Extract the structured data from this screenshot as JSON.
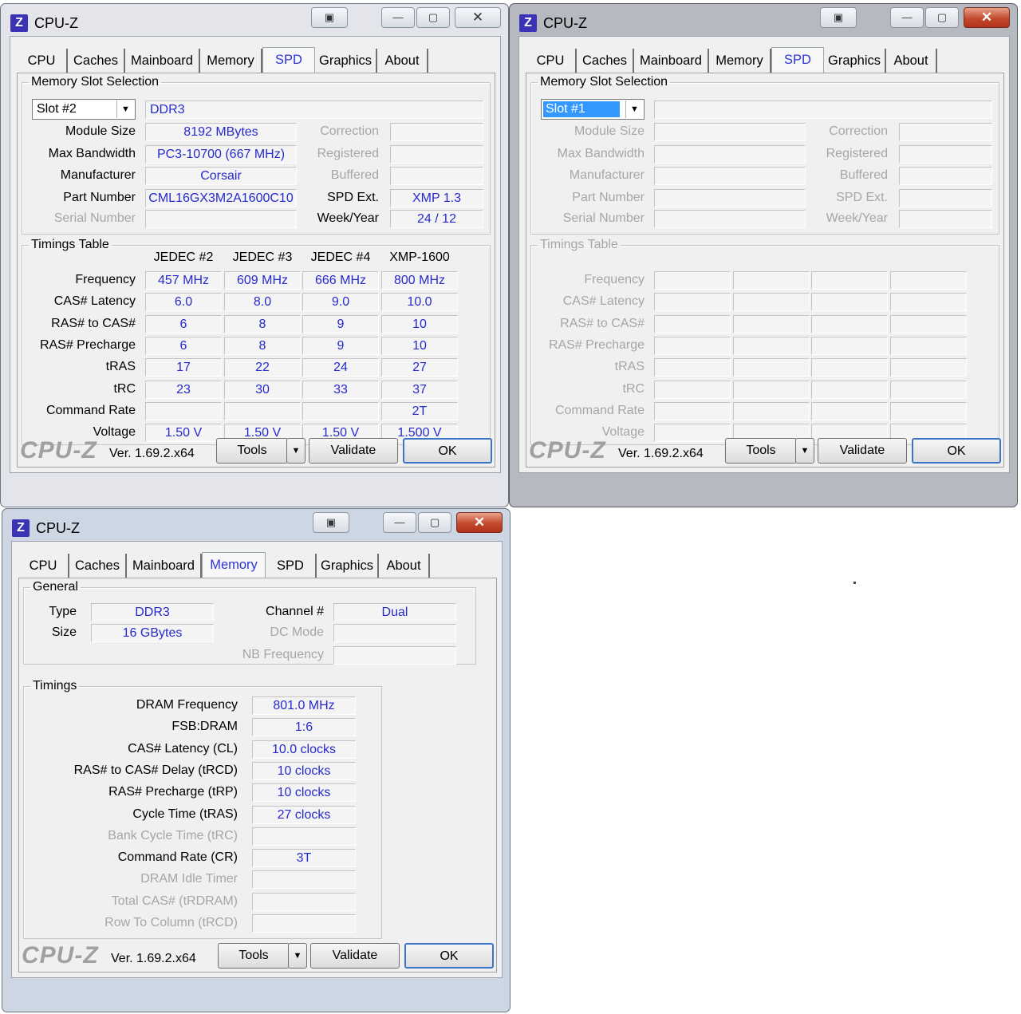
{
  "app_title": "CPU-Z",
  "app_icon_letter": "Z",
  "logo": "CPU-Z",
  "version": "Ver. 1.69.2.x64",
  "buttons": {
    "tools": "Tools",
    "validate": "Validate",
    "ok": "OK",
    "dropdown_glyph": "▼",
    "minimize": "—",
    "maximize": "▢",
    "close": "✕"
  },
  "tabs": [
    "CPU",
    "Caches",
    "Mainboard",
    "Memory",
    "SPD",
    "Graphics",
    "About"
  ],
  "spd_labels": {
    "group_slot": "Memory Slot Selection",
    "module_size": "Module Size",
    "max_bandwidth": "Max Bandwidth",
    "manufacturer": "Manufacturer",
    "part_number": "Part Number",
    "serial_number": "Serial Number",
    "correction": "Correction",
    "registered": "Registered",
    "buffered": "Buffered",
    "spd_ext": "SPD Ext.",
    "week_year": "Week/Year",
    "group_timings": "Timings Table",
    "row_labels": [
      "Frequency",
      "CAS# Latency",
      "RAS# to CAS#",
      "RAS# Precharge",
      "tRAS",
      "tRC",
      "Command Rate",
      "Voltage"
    ]
  },
  "spd_slot2": {
    "slot": "Slot #2",
    "type": "DDR3",
    "module_size": "8192 MBytes",
    "max_bandwidth": "PC3-10700 (667 MHz)",
    "manufacturer": "Corsair",
    "part_number": "CML16GX3M2A1600C10",
    "spd_ext": "XMP 1.3",
    "week_year": "24 / 12",
    "columns": [
      "JEDEC #2",
      "JEDEC #3",
      "JEDEC #4",
      "XMP-1600"
    ],
    "rows": [
      [
        "457 MHz",
        "609 MHz",
        "666 MHz",
        "800 MHz"
      ],
      [
        "6.0",
        "8.0",
        "9.0",
        "10.0"
      ],
      [
        "6",
        "8",
        "9",
        "10"
      ],
      [
        "6",
        "8",
        "9",
        "10"
      ],
      [
        "17",
        "22",
        "24",
        "27"
      ],
      [
        "23",
        "30",
        "33",
        "37"
      ],
      [
        "",
        "",
        "",
        "2T"
      ],
      [
        "1.50 V",
        "1.50 V",
        "1.50 V",
        "1.500 V"
      ]
    ]
  },
  "spd_slot1": {
    "slot": "Slot #1"
  },
  "memory": {
    "group_general": "General",
    "type_label": "Type",
    "type": "DDR3",
    "size_label": "Size",
    "size": "16 GBytes",
    "channel_label": "Channel #",
    "channel": "Dual",
    "dc_mode_label": "DC Mode",
    "nb_freq_label": "NB Frequency",
    "group_timings": "Timings",
    "timings": [
      {
        "label": "DRAM Frequency",
        "value": "801.0 MHz",
        "enabled": true
      },
      {
        "label": "FSB:DRAM",
        "value": "1:6",
        "enabled": true
      },
      {
        "label": "CAS# Latency (CL)",
        "value": "10.0 clocks",
        "enabled": true
      },
      {
        "label": "RAS# to CAS# Delay (tRCD)",
        "value": "10 clocks",
        "enabled": true
      },
      {
        "label": "RAS# Precharge (tRP)",
        "value": "10 clocks",
        "enabled": true
      },
      {
        "label": "Cycle Time (tRAS)",
        "value": "27 clocks",
        "enabled": true
      },
      {
        "label": "Bank Cycle Time (tRC)",
        "value": "",
        "enabled": false
      },
      {
        "label": "Command Rate (CR)",
        "value": "3T",
        "enabled": true
      },
      {
        "label": "DRAM Idle Timer",
        "value": "",
        "enabled": false
      },
      {
        "label": "Total CAS# (tRDRAM)",
        "value": "",
        "enabled": false
      },
      {
        "label": "Row To Column (tRCD)",
        "value": "",
        "enabled": false
      }
    ]
  }
}
